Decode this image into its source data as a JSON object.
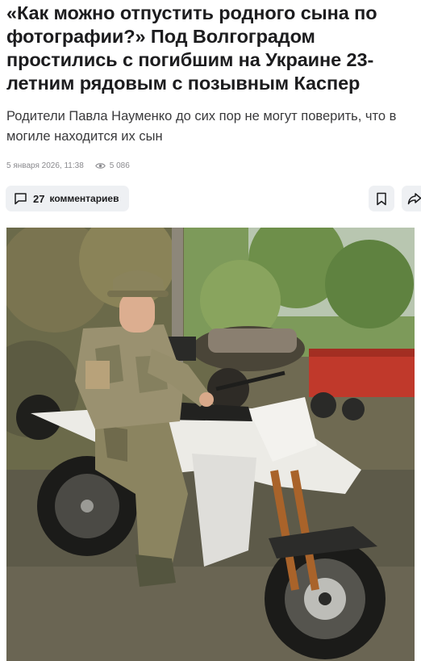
{
  "article": {
    "headline": "«Как можно отпустить родного сына по фотографии?» Под Волгоградом простились с погибшим на Украине 23-летним рядовым с позывным Каспер",
    "lead": "Родители Павла Науменко до сих пор не могут поверить, что в могиле находится их сын",
    "date": "5 января 2026, 11:38",
    "views": "5 086"
  },
  "actions": {
    "comments_count": "27",
    "comments_label": "комментариев"
  },
  "icons": {
    "views": "eye-icon",
    "comments": "comment-bubble-icon",
    "bookmark": "bookmark-icon",
    "share": "share-arrow-icon"
  },
  "colors": {
    "button_bg": "#eef0f3",
    "text": "#1c1c1e",
    "muted": "#8a8a8e"
  }
}
